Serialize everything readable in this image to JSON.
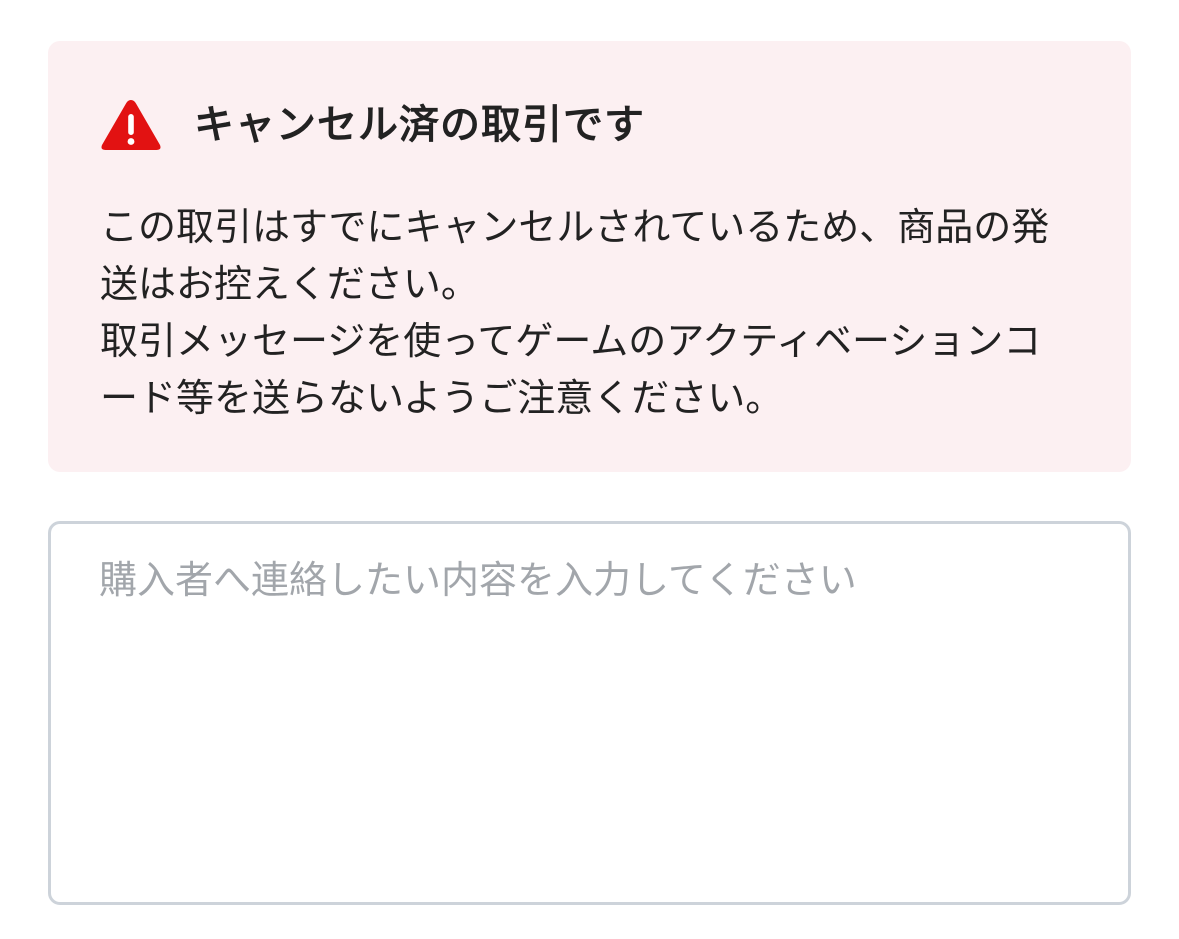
{
  "alert": {
    "icon": "warning-triangle-icon",
    "icon_color": "#e21212",
    "background_color": "#fcf0f2",
    "title": "キャンセル済の取引です",
    "paragraph1": "この取引はすでにキャンセルされているため、商品の発送はお控えください。",
    "paragraph2": "取引メッセージを使ってゲームのアクティベーションコード等を送らないようご注意ください。"
  },
  "message": {
    "placeholder": "購入者へ連絡したい内容を入力してください",
    "value": ""
  }
}
